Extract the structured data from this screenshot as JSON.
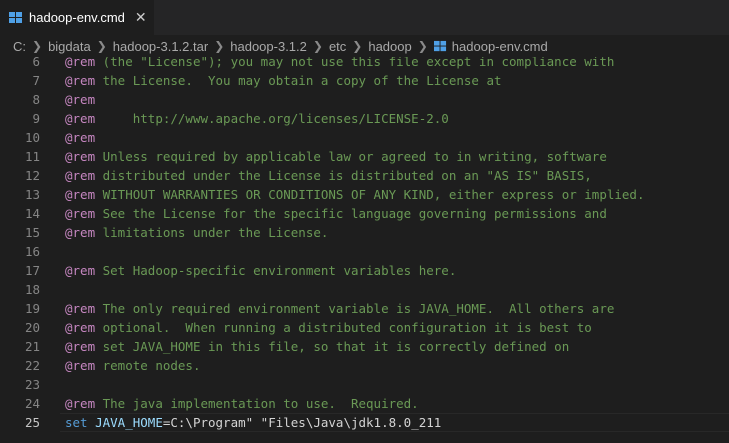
{
  "tab": {
    "label": "hadoop-env.cmd",
    "close_glyph": "✕"
  },
  "breadcrumb": [
    "C:",
    "bigdata",
    "hadoop-3.1.2.tar",
    "hadoop-3.1.2",
    "etc",
    "hadoop",
    "hadoop-env.cmd"
  ],
  "editor": {
    "lines": [
      {
        "n": "6",
        "rem": "@rem",
        "text": " (the \"License\"); you may not use this file except in compliance with"
      },
      {
        "n": "7",
        "rem": "@rem",
        "text": " the License.  You may obtain a copy of the License at"
      },
      {
        "n": "8",
        "rem": "@rem",
        "text": ""
      },
      {
        "n": "9",
        "rem": "@rem",
        "text": "     http://www.apache.org/licenses/LICENSE-2.0",
        "link": true
      },
      {
        "n": "10",
        "rem": "@rem",
        "text": ""
      },
      {
        "n": "11",
        "rem": "@rem",
        "text": " Unless required by applicable law or agreed to in writing, software"
      },
      {
        "n": "12",
        "rem": "@rem",
        "text": " distributed under the License is distributed on an \"AS IS\" BASIS,"
      },
      {
        "n": "13",
        "rem": "@rem",
        "text": " WITHOUT WARRANTIES OR CONDITIONS OF ANY KIND, either express or implied."
      },
      {
        "n": "14",
        "rem": "@rem",
        "text": " See the License for the specific language governing permissions and"
      },
      {
        "n": "15",
        "rem": "@rem",
        "text": " limitations under the License."
      },
      {
        "n": "16",
        "rem": "",
        "text": ""
      },
      {
        "n": "17",
        "rem": "@rem",
        "text": " Set Hadoop-specific environment variables here."
      },
      {
        "n": "18",
        "rem": "",
        "text": ""
      },
      {
        "n": "19",
        "rem": "@rem",
        "text": " The only required environment variable is JAVA_HOME.  All others are"
      },
      {
        "n": "20",
        "rem": "@rem",
        "text": " optional.  When running a distributed configuration it is best to"
      },
      {
        "n": "21",
        "rem": "@rem",
        "text": " set JAVA_HOME in this file, so that it is correctly defined on"
      },
      {
        "n": "22",
        "rem": "@rem",
        "text": " remote nodes."
      },
      {
        "n": "23",
        "rem": "",
        "text": ""
      },
      {
        "n": "24",
        "rem": "@rem",
        "text": " The java implementation to use.  Required."
      }
    ],
    "last_line": {
      "n": "25",
      "set": "set",
      "var": "JAVA_HOME",
      "eq": "=C:\\Program\" \"Files\\Java\\jdk1.8.0_211"
    }
  },
  "icons": {
    "tab": "cmd-file-icon",
    "close": "close-icon",
    "crumb_sep": "chevron-right-icon"
  },
  "colors": {
    "background": "#1e1e1e",
    "comment": "#6a9955",
    "keyword": "#569cd6",
    "variable": "#9cdcfe"
  }
}
